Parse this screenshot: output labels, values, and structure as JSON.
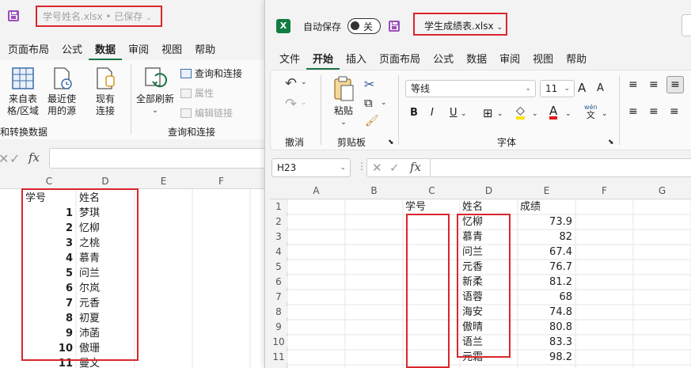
{
  "back_window": {
    "title": "学号姓名.xlsx • 已保存",
    "title_caret": "⌄",
    "menu": [
      "页面布局",
      "公式",
      "数据",
      "审阅",
      "视图",
      "帮助"
    ],
    "active_menu": "数据",
    "ribbon": {
      "btn_from_table": [
        "来自表",
        "格/区域"
      ],
      "btn_recent": [
        "最近使",
        "用的源"
      ],
      "btn_existing": [
        "现有",
        "连接"
      ],
      "btn_refresh_all": "全部刷新",
      "query_connections": "查询和连接",
      "properties": "属性",
      "edit_links": "编辑链接",
      "group_get_transform": "和转换数据",
      "group_query": "查询和连接"
    },
    "formula_bar": {
      "fx": "fx"
    },
    "columns": [
      "C",
      "D",
      "E",
      "F"
    ],
    "header_row": {
      "C": "学号",
      "D": "姓名"
    },
    "rows": [
      {
        "C": "1",
        "D": "梦琪"
      },
      {
        "C": "2",
        "D": "忆柳"
      },
      {
        "C": "3",
        "D": "之桃"
      },
      {
        "C": "4",
        "D": "慕青"
      },
      {
        "C": "5",
        "D": "问兰"
      },
      {
        "C": "6",
        "D": "尔岚"
      },
      {
        "C": "7",
        "D": "元香"
      },
      {
        "C": "8",
        "D": "初夏"
      },
      {
        "C": "9",
        "D": "沛菡"
      },
      {
        "C": "10",
        "D": "傲珊"
      },
      {
        "C": "11",
        "D": "曼文"
      }
    ]
  },
  "front_window": {
    "autosave_label": "自动保存",
    "toggle_state": "关",
    "file_title": "学生成绩表.xlsx",
    "title_caret": "⌄",
    "menu": [
      "文件",
      "开始",
      "插入",
      "页面布局",
      "公式",
      "数据",
      "审阅",
      "视图",
      "帮助"
    ],
    "active_menu": "开始",
    "ribbon": {
      "undo_group": "撤消",
      "paste_label": "粘贴",
      "clipboard_group": "剪贴板",
      "font_name": "等线",
      "font_size": "11",
      "font_group": "字体",
      "bold": "B",
      "italic": "I",
      "underline": "U",
      "font_color_letter": "A",
      "grow_font": "A",
      "shrink_font": "A",
      "phonetic_top": "wén",
      "phonetic_bottom": "文"
    },
    "name_box": "H23",
    "fx": "fx",
    "columns": [
      "A",
      "B",
      "C",
      "D",
      "E",
      "F",
      "G"
    ],
    "row_numbers": [
      "1",
      "2",
      "3",
      "4",
      "5",
      "6",
      "7",
      "8",
      "9",
      "10",
      "11"
    ],
    "header_row": {
      "C": "学号",
      "D": "姓名",
      "E": "成绩"
    },
    "rows": [
      {
        "D": "忆柳",
        "E": "73.9"
      },
      {
        "D": "慕青",
        "E": "82"
      },
      {
        "D": "问兰",
        "E": "67.4"
      },
      {
        "D": "元香",
        "E": "76.7"
      },
      {
        "D": "新柔",
        "E": "81.2"
      },
      {
        "D": "语蓉",
        "E": "68"
      },
      {
        "D": "海安",
        "E": "74.8"
      },
      {
        "D": "傲晴",
        "E": "80.8"
      },
      {
        "D": "语兰",
        "E": "83.3"
      },
      {
        "D": "元霜",
        "E": "98.2"
      }
    ]
  },
  "colors": {
    "accent_green": "#1b7343",
    "highlight_red": "#d9262c",
    "excel_green": "#107c41"
  }
}
